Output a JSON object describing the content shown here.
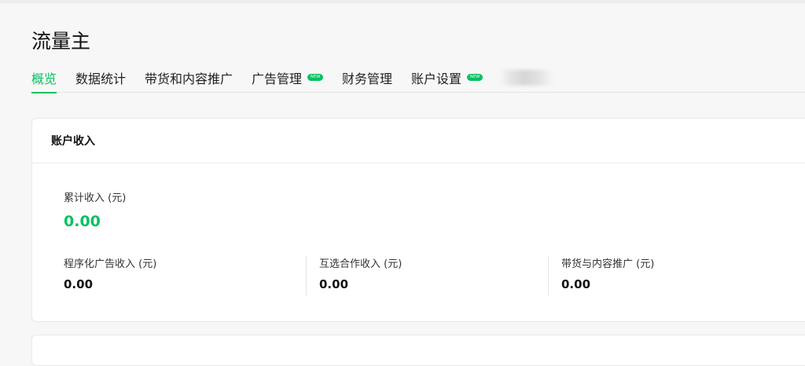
{
  "page": {
    "title": "流量主"
  },
  "tabs": [
    {
      "label": "概览",
      "active": true,
      "badge": ""
    },
    {
      "label": "数据统计",
      "active": false,
      "badge": ""
    },
    {
      "label": "带货和内容推广",
      "active": false,
      "badge": ""
    },
    {
      "label": "广告管理",
      "active": false,
      "badge": "NEW"
    },
    {
      "label": "财务管理",
      "active": false,
      "badge": ""
    },
    {
      "label": "账户设置",
      "active": false,
      "badge": "NEW"
    }
  ],
  "income": {
    "title": "账户收入",
    "total_label": "累计收入 (元)",
    "total_value": "0.00",
    "stats": [
      {
        "label": "程序化广告收入 (元)",
        "value": "0.00"
      },
      {
        "label": "互选合作收入 (元)",
        "value": "0.00"
      },
      {
        "label": "带货与内容推广 (元)",
        "value": "0.00"
      }
    ]
  },
  "colors": {
    "accent": "#07c160",
    "background": "#f7f7f7",
    "card": "#ffffff"
  }
}
